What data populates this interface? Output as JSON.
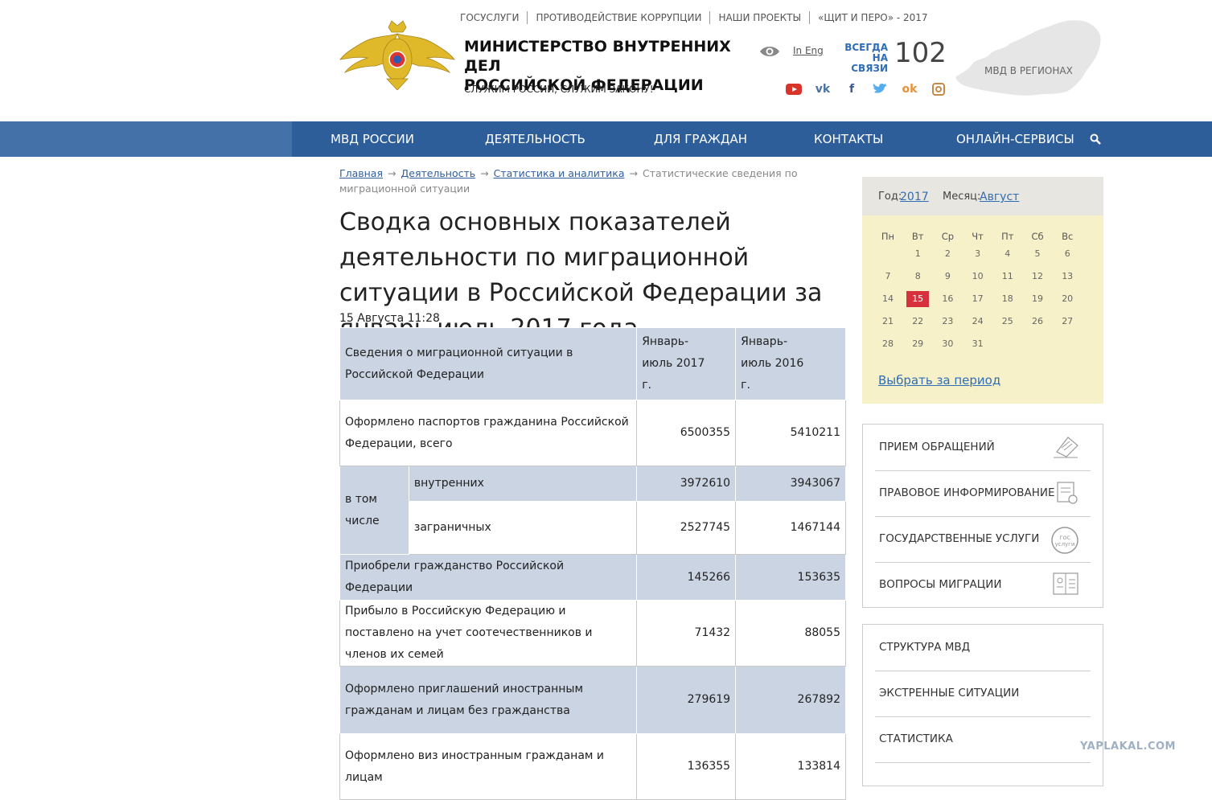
{
  "top_links": [
    "ГОСУСЛУГИ",
    "ПРОТИВОДЕЙСТВИЕ КОРРУПЦИИ",
    "НАШИ ПРОЕКТЫ",
    "«ЩИТ И ПЕРО» - 2017"
  ],
  "header": {
    "title_line1": "МИНИСТЕРСТВО ВНУТРЕННИХ ДЕЛ",
    "title_line2": "РОССИЙСКОЙ ФЕДЕРАЦИИ",
    "slogan": "СЛУЖИМ РОССИИ, СЛУЖИМ ЗАКОНУ!",
    "lang_link": "In Eng",
    "always_line1": "ВСЕГДА",
    "always_line2": "НА СВЯЗИ",
    "phone": "102",
    "regions_label": "МВД В РЕГИОНАХ"
  },
  "socials": [
    "youtube-icon",
    "vk-icon",
    "facebook-icon",
    "twitter-icon",
    "odnoklassniki-icon",
    "instagram-icon"
  ],
  "nav": [
    "МВД РОССИИ",
    "ДЕЯТЕЛЬНОСТЬ",
    "ДЛЯ ГРАЖДАН",
    "КОНТАКТЫ",
    "ОНЛАЙН-СЕРВИСЫ"
  ],
  "breadcrumbs": {
    "home": "Главная",
    "activity": "Деятельность",
    "stats": "Статистика и аналитика",
    "current": "Статистические сведения по миграционной ситуации",
    "arrow": "→"
  },
  "article": {
    "title": "Сводка основных показателей деятельности по миграционной ситуации в Российской Федерации за январь-июль 2017 года",
    "date": "15 Августа 11:28"
  },
  "table": {
    "header": {
      "label": "Сведения о миграционной ситуации в Российской Федерации",
      "col1": "Январь-июль 2017 г.",
      "col2": "Январь-июль 2016 г."
    },
    "passports": {
      "label": "Оформлено паспортов гражданина Российской Федерации, всего",
      "v2017": "6500355",
      "v2016": "5410211"
    },
    "including": "в том числе",
    "internal": {
      "label": "внутренних",
      "v2017": "3972610",
      "v2016": "3943067"
    },
    "foreign": {
      "label": "заграничных",
      "v2017": "2527745",
      "v2016": "1467144"
    },
    "citizenship": {
      "label": "Приобрели гражданство Российской Федерации",
      "v2017": "145266",
      "v2016": "153635"
    },
    "compatriots": {
      "label": "Прибыло в Российскую Федерацию и поставлено на учет соотечественников и членов их семей",
      "v2017": "71432",
      "v2016": "88055"
    },
    "invitations": {
      "label": "Оформлено приглашений иностранным гражданам и лицам без гражданства",
      "v2017": "279619",
      "v2016": "267892"
    },
    "visas": {
      "label": "Оформлено виз иностранным гражданам и лицам",
      "v2017": "136355",
      "v2016": "133814"
    }
  },
  "calendar": {
    "year_label": "Год:",
    "year": "2017",
    "month_label": "Месяц:",
    "month": "Август",
    "weekdays": [
      "Пн",
      "Вт",
      "Ср",
      "Чт",
      "Пт",
      "Сб",
      "Вс"
    ],
    "days": [
      "1",
      "2",
      "3",
      "4",
      "5",
      "6",
      "7",
      "8",
      "9",
      "10",
      "11",
      "12",
      "13",
      "14",
      "15",
      "16",
      "17",
      "18",
      "19",
      "20",
      "21",
      "22",
      "23",
      "24",
      "25",
      "26",
      "27",
      "28",
      "29",
      "30",
      "31"
    ],
    "today": "15",
    "period_link": "Выбрать за период"
  },
  "services": [
    "ПРИЕМ ОБРАЩЕНИЙ",
    "ПРАВОВОЕ ИНФОРМИРОВАНИЕ",
    "ГОСУДАРСТВЕННЫЕ УСЛУГИ",
    "ВОПРОСЫ МИГРАЦИИ"
  ],
  "sections": [
    "СТРУКТУРА МВД",
    "ЭКСТРЕННЫЕ СИТУАЦИИ",
    "СТАТИСТИКА"
  ],
  "watermark": "YAPLAKAL.COM",
  "colors": {
    "nav": "#2d5e9a",
    "table_shade": "#cad4e2",
    "calendar_bg": "#f6f1c9",
    "today": "#d7313d"
  }
}
